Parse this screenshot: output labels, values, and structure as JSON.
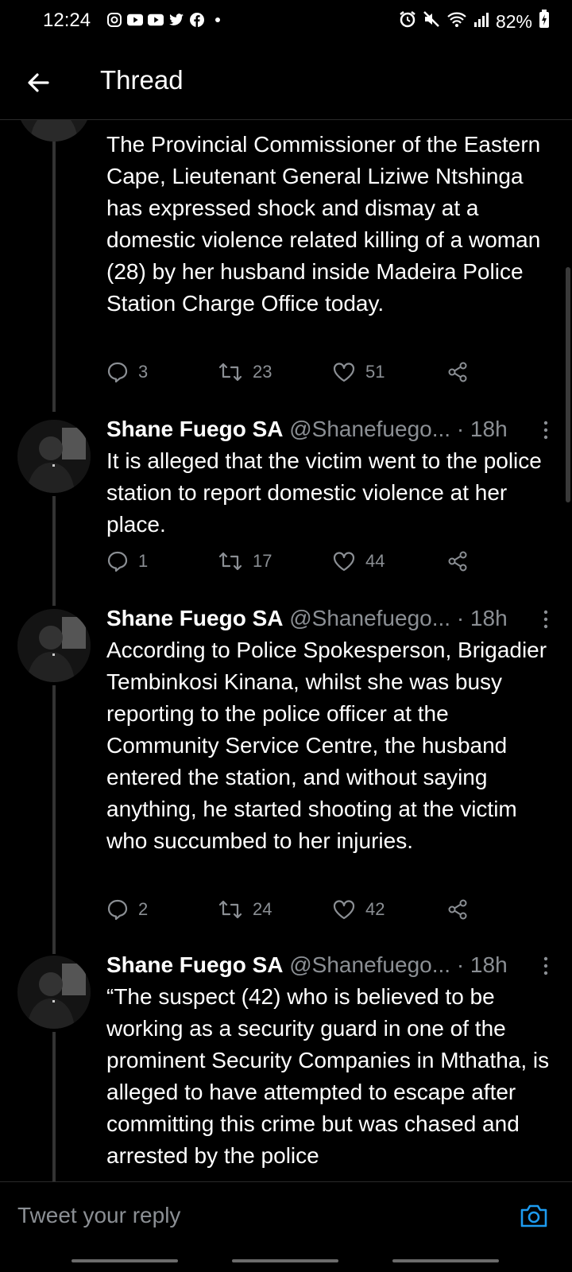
{
  "status_bar": {
    "time": "12:24",
    "app_icons": [
      "instagram-icon",
      "youtube-icon",
      "youtube-icon",
      "twitter-icon",
      "facebook-icon",
      "dot-icon"
    ],
    "right_icons": [
      "alarm-icon",
      "mute-icon",
      "wifi-icon",
      "signal-icon"
    ],
    "battery": "82%"
  },
  "header": {
    "title": "Thread"
  },
  "tweets": [
    {
      "text": "The Provincial Commissioner of the Eastern Cape, Lieutenant General Liziwe Ntshinga has expressed shock and dismay at a domestic violence related killing of a woman (28) by her husband inside Madeira Police Station Charge Office today.",
      "replies": "3",
      "retweets": "23",
      "likes": "51"
    },
    {
      "name": "Shane Fuego SA",
      "handle": "@Shanefuego...",
      "time": "· 18h",
      "text": "It is alleged that the victim went to the police station to report domestic violence at her place.",
      "replies": "1",
      "retweets": "17",
      "likes": "44"
    },
    {
      "name": "Shane Fuego SA",
      "handle": "@Shanefuego...",
      "time": "· 18h",
      "text": "According to Police Spokesperson, Brigadier Tembinkosi Kinana, whilst she was busy reporting to the police officer at the Community Service Centre, the husband entered the station, and without saying anything, he started shooting at the victim who succumbed to her injuries.",
      "replies": "2",
      "retweets": "24",
      "likes": "42"
    },
    {
      "name": "Shane Fuego SA",
      "handle": "@Shanefuego...",
      "time": "· 18h",
      "text": "“The suspect (42) who is believed to be working as a security guard in one of the prominent Security Companies in Mthatha, is alleged to have attempted to escape after committing this crime but was chased and arrested by the police"
    }
  ],
  "reply_bar": {
    "placeholder": "Tweet your reply"
  },
  "colors": {
    "background": "#000000",
    "secondary_text": "#8b8f94",
    "accent": "#1d9bf0"
  }
}
